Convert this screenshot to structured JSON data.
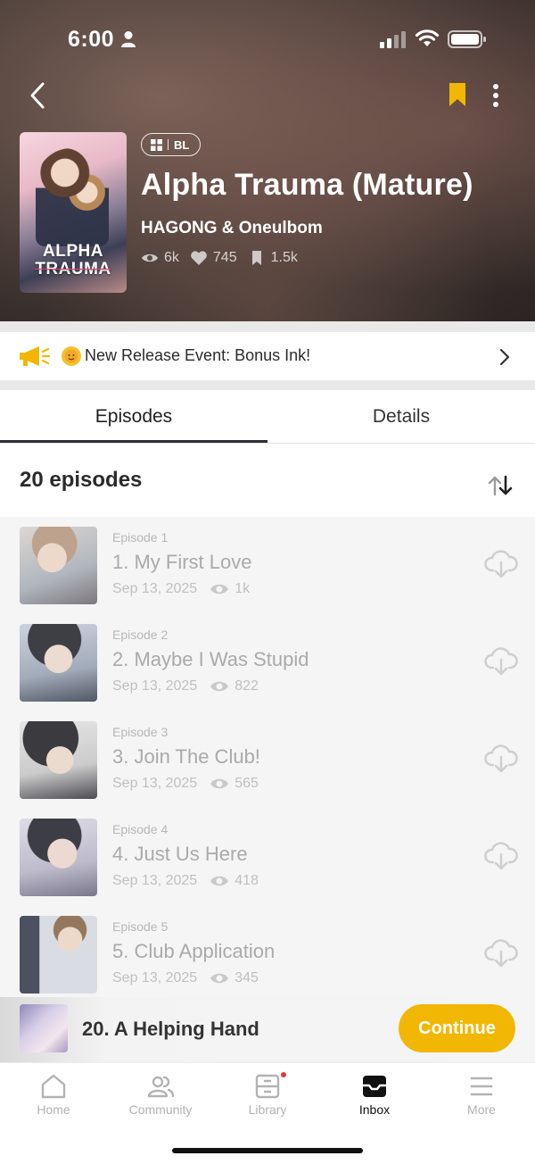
{
  "status_bar": {
    "time": "6:00"
  },
  "series": {
    "genre_badge": "BL",
    "title": "Alpha Trauma (Mature)",
    "authors": "HAGONG & Oneulbom",
    "views": "6k",
    "likes": "745",
    "subscribers": "1.5k",
    "cover_text_line1": "ALPHA",
    "cover_text_line2": "TRAUMA"
  },
  "event_banner": {
    "text": "New Release Event: Bonus Ink!"
  },
  "tabs": [
    {
      "label": "Episodes",
      "active": true
    },
    {
      "label": "Details",
      "active": false
    }
  ],
  "episodes_header": {
    "count": "20 episodes"
  },
  "episodes": [
    {
      "kicker": "Episode 1",
      "title": "1. My First Love",
      "date": "Sep 13, 2025",
      "views": "1k"
    },
    {
      "kicker": "Episode 2",
      "title": "2. Maybe I Was Stupid",
      "date": "Sep 13, 2025",
      "views": "822"
    },
    {
      "kicker": "Episode 3",
      "title": "3. Join The Club!",
      "date": "Sep 13, 2025",
      "views": "565"
    },
    {
      "kicker": "Episode 4",
      "title": "4. Just Us Here",
      "date": "Sep 13, 2025",
      "views": "418"
    },
    {
      "kicker": "Episode 5",
      "title": "5. Club Application",
      "date": "Sep 13, 2025",
      "views": "345"
    }
  ],
  "continue_bar": {
    "title": "20. A Helping Hand",
    "button_label": "Continue"
  },
  "bottom_nav": [
    {
      "label": "Home",
      "icon": "home-icon"
    },
    {
      "label": "Community",
      "icon": "community-icon"
    },
    {
      "label": "Library",
      "icon": "library-icon"
    },
    {
      "label": "Inbox",
      "icon": "inbox-icon"
    },
    {
      "label": "More",
      "icon": "menu-icon"
    }
  ],
  "colors": {
    "accent": "#f2b705",
    "bookmark": "#f2b705",
    "notification": "#e53935"
  }
}
